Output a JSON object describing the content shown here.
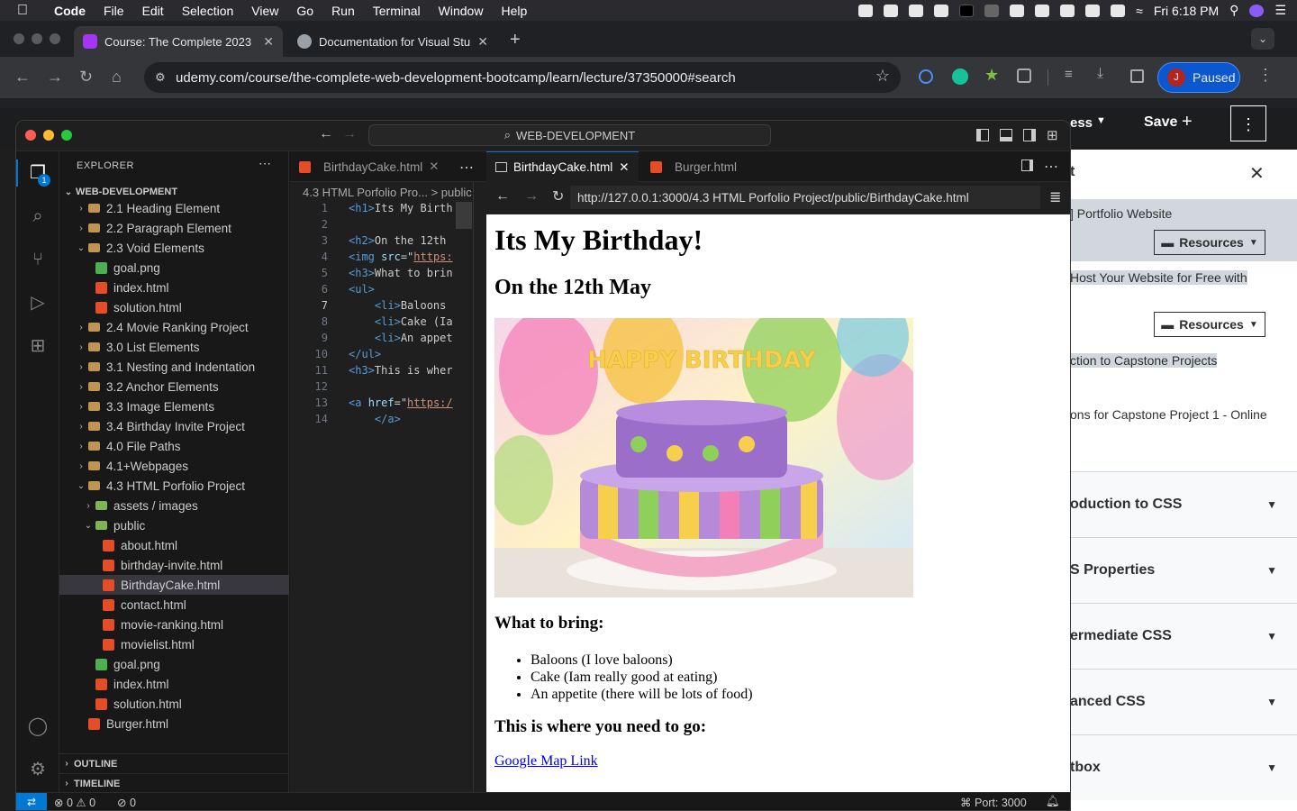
{
  "mac_menubar": {
    "app": "Code",
    "menus": [
      "File",
      "Edit",
      "Selection",
      "View",
      "Go",
      "Run",
      "Terminal",
      "Window",
      "Help"
    ],
    "clock": "Fri 6:18 PM"
  },
  "browser": {
    "tabs": [
      {
        "title": "Course: The Complete 2023 W",
        "active": true
      },
      {
        "title": "Documentation for Visual Stu",
        "active": false
      }
    ],
    "url": "udemy.com/course/the-complete-web-development-bootcamp/learn/lecture/37350000#search",
    "profile_initial": "J",
    "profile_status": "Paused"
  },
  "udemy": {
    "nav_partial": "ess",
    "save_label": "Save",
    "panel_title_partial": "t",
    "items": [
      {
        "text": "] Portfolio Website",
        "highlight": true
      },
      {
        "text": "Host Your Website for Free with",
        "highlight": true
      },
      {
        "text": "ction to Capstone Projects",
        "highlight": true
      },
      {
        "text": "ons for Capstone Project 1 - Online",
        "highlight": false
      }
    ],
    "resources_label": "Resources",
    "sections": [
      "oduction to CSS",
      "S Properties",
      "ermediate CSS",
      "anced CSS",
      "tbox"
    ]
  },
  "vscode": {
    "command_center": "WEB-DEVELOPMENT",
    "explorer_title": "EXPLORER",
    "explorer_badge": "1",
    "root_folder": "WEB-DEVELOPMENT",
    "tree": [
      {
        "label": "2.1 Heading Element",
        "type": "folder",
        "depth": 1,
        "open": false
      },
      {
        "label": "2.2 Paragraph Element",
        "type": "folder",
        "depth": 1,
        "open": false
      },
      {
        "label": "2.3 Void Elements",
        "type": "folder",
        "depth": 1,
        "open": true
      },
      {
        "label": "goal.png",
        "type": "png",
        "depth": 2
      },
      {
        "label": "index.html",
        "type": "html",
        "depth": 2
      },
      {
        "label": "solution.html",
        "type": "html",
        "depth": 2
      },
      {
        "label": "2.4 Movie Ranking Project",
        "type": "folder",
        "depth": 1,
        "open": false
      },
      {
        "label": "3.0 List Elements",
        "type": "folder",
        "depth": 1,
        "open": false
      },
      {
        "label": "3.1 Nesting and Indentation",
        "type": "folder",
        "depth": 1,
        "open": false
      },
      {
        "label": "3.2 Anchor Elements",
        "type": "folder",
        "depth": 1,
        "open": false
      },
      {
        "label": "3.3 Image Elements",
        "type": "folder",
        "depth": 1,
        "open": false
      },
      {
        "label": "3.4 Birthday Invite Project",
        "type": "folder",
        "depth": 1,
        "open": false
      },
      {
        "label": "4.0 File Paths",
        "type": "folder",
        "depth": 1,
        "open": false
      },
      {
        "label": "4.1+Webpages",
        "type": "folder",
        "depth": 1,
        "open": false
      },
      {
        "label": "4.3 HTML Porfolio Project",
        "type": "folder",
        "depth": 1,
        "open": true
      },
      {
        "label": "assets / images",
        "type": "folderg",
        "depth": 2,
        "open": false
      },
      {
        "label": "public",
        "type": "folderg",
        "depth": 2,
        "open": true
      },
      {
        "label": "about.html",
        "type": "html",
        "depth": 3
      },
      {
        "label": "birthday-invite.html",
        "type": "html",
        "depth": 3
      },
      {
        "label": "BirthdayCake.html",
        "type": "html",
        "depth": 3,
        "selected": true
      },
      {
        "label": "contact.html",
        "type": "html",
        "depth": 3
      },
      {
        "label": "movie-ranking.html",
        "type": "html",
        "depth": 3
      },
      {
        "label": "movielist.html",
        "type": "html",
        "depth": 3
      },
      {
        "label": "goal.png",
        "type": "png",
        "depth": 2
      },
      {
        "label": "index.html",
        "type": "html",
        "depth": 2
      },
      {
        "label": "solution.html",
        "type": "html",
        "depth": 2
      },
      {
        "label": "Burger.html",
        "type": "html",
        "depth": 1
      }
    ],
    "outline_label": "OUTLINE",
    "timeline_label": "TIMELINE",
    "editor_tab": "BirthdayCake.html",
    "breadcrumb": "4.3 HTML Porfolio Pro... > public",
    "preview_tabs": [
      "BirthdayCake.html",
      "Burger.html"
    ],
    "preview_url": "http://127.0.0.1:3000/4.3 HTML Porfolio Project/public/BirthdayCake.html",
    "code_lines": [
      {
        "n": "1",
        "parts": [
          {
            "c": "tag",
            "t": "<h1>"
          },
          {
            "c": "",
            "t": "Its My Birth"
          }
        ]
      },
      {
        "n": "2",
        "parts": []
      },
      {
        "n": "3",
        "parts": [
          {
            "c": "tag",
            "t": "<h2>"
          },
          {
            "c": "",
            "t": "On the 12th"
          }
        ]
      },
      {
        "n": "4",
        "parts": [
          {
            "c": "tag",
            "t": "<img "
          },
          {
            "c": "att",
            "t": "src"
          },
          {
            "c": "",
            "t": "=\""
          },
          {
            "c": "str",
            "t": "https:"
          }
        ]
      },
      {
        "n": "5",
        "parts": [
          {
            "c": "tag",
            "t": "<h3>"
          },
          {
            "c": "",
            "t": "What to brin"
          }
        ]
      },
      {
        "n": "6",
        "parts": [
          {
            "c": "tag",
            "t": "<ul>"
          }
        ]
      },
      {
        "n": "7",
        "parts": [
          {
            "c": "",
            "t": "    "
          },
          {
            "c": "tag",
            "t": "<li>"
          },
          {
            "c": "",
            "t": "Baloons"
          }
        ]
      },
      {
        "n": "8",
        "parts": [
          {
            "c": "",
            "t": "    "
          },
          {
            "c": "tag",
            "t": "<li>"
          },
          {
            "c": "",
            "t": "Cake (Ia"
          }
        ]
      },
      {
        "n": "9",
        "parts": [
          {
            "c": "",
            "t": "    "
          },
          {
            "c": "tag",
            "t": "<li>"
          },
          {
            "c": "",
            "t": "An appet"
          }
        ]
      },
      {
        "n": "10",
        "parts": [
          {
            "c": "tag",
            "t": "</ul>"
          }
        ]
      },
      {
        "n": "11",
        "parts": [
          {
            "c": "tag",
            "t": "<h3>"
          },
          {
            "c": "",
            "t": "This is wher"
          }
        ]
      },
      {
        "n": "12",
        "parts": []
      },
      {
        "n": "13",
        "parts": [
          {
            "c": "tag",
            "t": "<a "
          },
          {
            "c": "att",
            "t": "href"
          },
          {
            "c": "",
            "t": "=\""
          },
          {
            "c": "str",
            "t": "https:/"
          }
        ]
      },
      {
        "n": "14",
        "parts": [
          {
            "c": "",
            "t": "    "
          },
          {
            "c": "tag",
            "t": "</a>"
          }
        ]
      }
    ],
    "status_errors": "0",
    "status_warnings": "0",
    "status_ports": "0",
    "status_port": "Port: 3000"
  },
  "rendered_page": {
    "h1": "Its My Birthday!",
    "h2": "On the 12th May",
    "h3_bring": "What to bring:",
    "list": [
      "Baloons (I love baloons)",
      "Cake (Iam really good at eating)",
      "An appetite (there will be lots of food)"
    ],
    "h3_where": "This is where you need to go:",
    "link": "Google Map Link",
    "cake_text": "HAPPY BIRTHDAY"
  }
}
